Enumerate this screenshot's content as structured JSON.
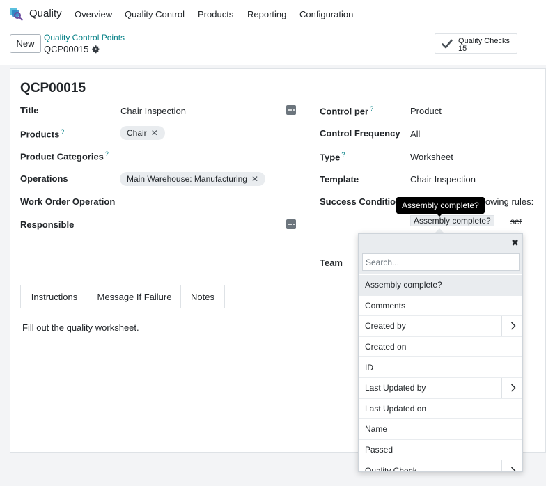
{
  "nav": {
    "app_name": "Quality",
    "menus": [
      "Overview",
      "Quality Control",
      "Products",
      "Reporting",
      "Configuration"
    ]
  },
  "control_panel": {
    "new_label": "New",
    "breadcrumb_parent": "Quality Control Points",
    "breadcrumb_current": "QCP00015",
    "smart_button": {
      "label": "Quality Checks",
      "count": "15"
    }
  },
  "form": {
    "reference": "QCP00015",
    "left": {
      "title_label": "Title",
      "title_value": "Chair Inspection",
      "products_label": "Products",
      "products_tags": [
        "Chair"
      ],
      "categories_label": "Product Categories",
      "operations_label": "Operations",
      "operations_tags": [
        "Main Warehouse: Manufacturing"
      ],
      "workorder_label": "Work Order Operation",
      "responsible_label": "Responsible"
    },
    "right": {
      "control_per_label": "Control per",
      "control_per_value": "Product",
      "frequency_label": "Control Frequency",
      "frequency_value": "All",
      "type_label": "Type",
      "type_value": "Worksheet",
      "template_label": "Template",
      "template_value": "Chair Inspection",
      "success_label": "Success Condition",
      "success_partial": "lowing rules:",
      "domain_field": "Assembly complete?",
      "domain_operator": "set",
      "team_label": "Team"
    },
    "help_mark": "?"
  },
  "tooltip": "Assembly complete?",
  "tabs": [
    {
      "label": "Instructions",
      "active": true
    },
    {
      "label": "Message If Failure",
      "active": false
    },
    {
      "label": "Notes",
      "active": false
    }
  ],
  "tab_content": "Fill out the quality worksheet.",
  "field_selector": {
    "close_glyph": "✖",
    "search_placeholder": "Search...",
    "items": [
      {
        "label": "Assembly complete?",
        "relation": false,
        "active": true
      },
      {
        "label": "Comments",
        "relation": false
      },
      {
        "label": "Created by",
        "relation": true
      },
      {
        "label": "Created on",
        "relation": false
      },
      {
        "label": "ID",
        "relation": false
      },
      {
        "label": "Last Updated by",
        "relation": true
      },
      {
        "label": "Last Updated on",
        "relation": false
      },
      {
        "label": "Name",
        "relation": false
      },
      {
        "label": "Passed",
        "relation": false
      },
      {
        "label": "Quality Check",
        "relation": true
      }
    ]
  },
  "colors": {
    "accent": "#017e84",
    "tooltip_bg": "#000000",
    "tag_bg": "#e9ecef"
  },
  "icons": {
    "app": "quality-app-icon",
    "gear": "gear-icon",
    "check": "check-icon",
    "more": "dots-icon",
    "chevron": "chevron-right-icon",
    "close": "close-icon"
  }
}
